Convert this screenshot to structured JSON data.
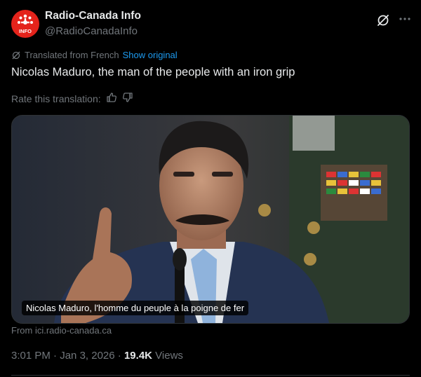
{
  "account": {
    "display_name": "Radio-Canada Info",
    "handle": "@RadioCanadaInfo",
    "avatar_label": "INFO",
    "avatar_color": "#e4231b"
  },
  "icons": {
    "grok": "grok-slash-circle-icon",
    "more": "more-horizontal-icon",
    "translate": "translate-icon",
    "thumbs_up": "thumbs-up-icon",
    "thumbs_down": "thumbs-down-icon"
  },
  "translation": {
    "notice": "Translated from French",
    "show_original": "Show original"
  },
  "tweet": {
    "text": "Nicolas Maduro, the man of the people with an iron grip"
  },
  "rating": {
    "label": "Rate this translation:"
  },
  "media": {
    "caption": "Nicolas Maduro, l'homme du peuple à la poigne de fer",
    "source": "From ici.radio-canada.ca"
  },
  "meta": {
    "time": "3:01 PM",
    "date": "Jan 3, 2026",
    "separator": "·",
    "views_count": "19.4K",
    "views_label": "Views"
  },
  "colors": {
    "background": "#000000",
    "text_primary": "#e7e9ea",
    "text_secondary": "#71767b",
    "link": "#1d9bf0",
    "border": "#2f3336"
  }
}
